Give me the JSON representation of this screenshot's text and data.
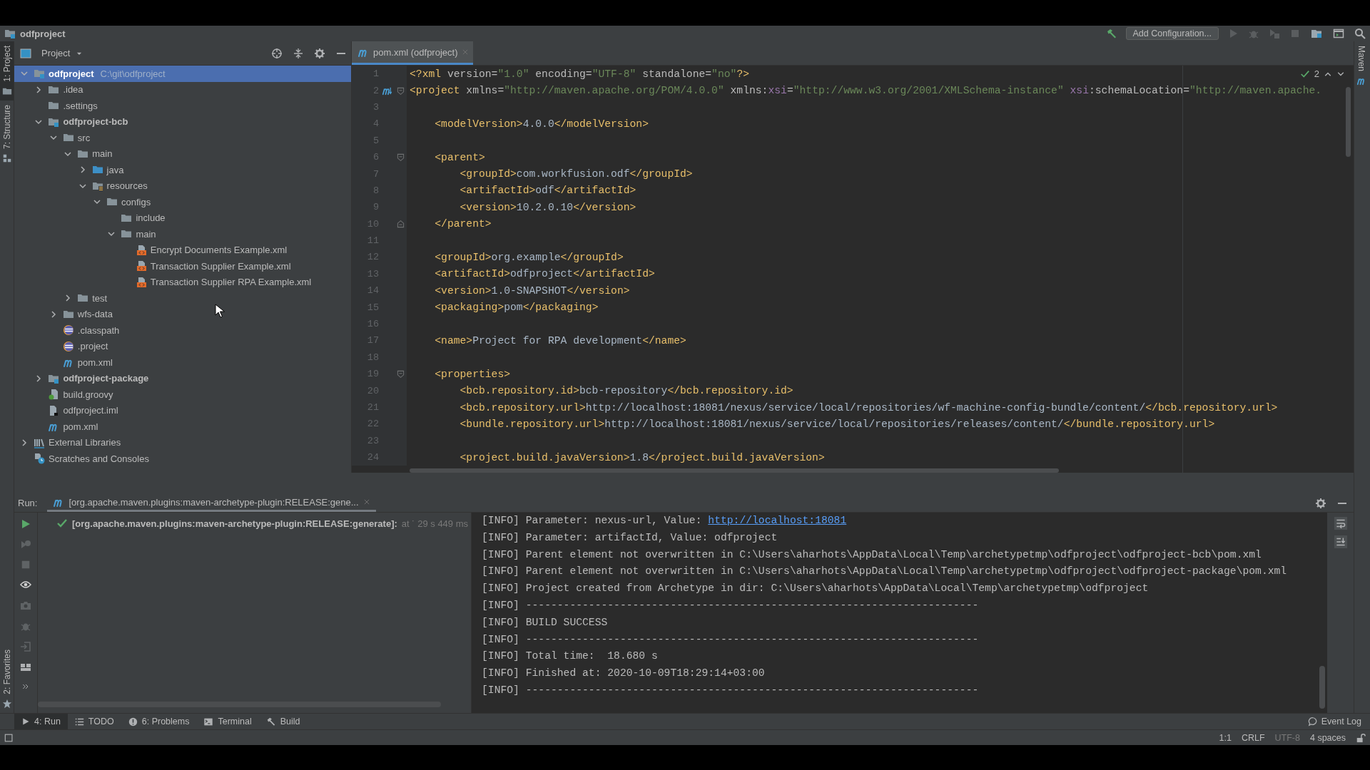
{
  "title_bar": {
    "project": "odfproject",
    "configuration_button": "Add Configuration..."
  },
  "left_strip": [
    {
      "label": "1: Project",
      "kind": "project",
      "selected": true
    },
    {
      "label": "7: Structure",
      "kind": "structure",
      "selected": false
    },
    {
      "label": "2: Favorites",
      "kind": "favorites",
      "selected": false
    }
  ],
  "right_strip": [
    {
      "label": "Maven",
      "selected": false
    }
  ],
  "project_panel": {
    "view": "Project",
    "tree": [
      {
        "label": "odfproject",
        "path": "C:\\git\\odfproject",
        "kind": "module",
        "selected": true,
        "expanded": true,
        "children": [
          {
            "label": ".idea",
            "kind": "folder",
            "selected": false,
            "expanded": false
          },
          {
            "label": ".settings",
            "kind": "folder",
            "selected": false
          },
          {
            "label": "odfproject-bcb",
            "kind": "module",
            "selected": false,
            "expanded": true,
            "children": [
              {
                "label": "src",
                "kind": "folder",
                "selected": false,
                "expanded": true,
                "children": [
                  {
                    "label": "main",
                    "kind": "folder",
                    "selected": false,
                    "expanded": true,
                    "children": [
                      {
                        "label": "java",
                        "kind": "source-folder",
                        "selected": false,
                        "expanded": false
                      },
                      {
                        "label": "resources",
                        "kind": "resources-folder",
                        "selected": false,
                        "expanded": true,
                        "children": [
                          {
                            "label": "configs",
                            "kind": "folder",
                            "selected": false,
                            "expanded": true,
                            "children": [
                              {
                                "label": "include",
                                "kind": "folder",
                                "selected": false
                              },
                              {
                                "label": "main",
                                "kind": "folder",
                                "selected": false,
                                "expanded": true,
                                "children": [
                                  {
                                    "label": "Encrypt Documents Example.xml",
                                    "kind": "xml-file",
                                    "selected": false
                                  },
                                  {
                                    "label": "Transaction Supplier Example.xml",
                                    "kind": "xml-file",
                                    "selected": false
                                  },
                                  {
                                    "label": "Transaction Supplier RPA Example.xml",
                                    "kind": "xml-file",
                                    "selected": false
                                  }
                                ]
                              }
                            ]
                          }
                        ]
                      }
                    ]
                  },
                  {
                    "label": "test",
                    "kind": "folder",
                    "selected": false,
                    "expanded": false
                  }
                ]
              },
              {
                "label": "wfs-data",
                "kind": "folder",
                "selected": false,
                "expanded": false
              },
              {
                "label": ".classpath",
                "kind": "eclipse-file",
                "selected": false
              },
              {
                "label": ".project",
                "kind": "eclipse-file",
                "selected": false
              },
              {
                "label": "pom.xml",
                "kind": "maven-file",
                "selected": false
              }
            ]
          },
          {
            "label": "odfproject-package",
            "kind": "module",
            "selected": false,
            "expanded": false
          },
          {
            "label": "build.groovy",
            "kind": "groovy-file",
            "selected": false
          },
          {
            "label": "odfproject.iml",
            "kind": "iml-file",
            "selected": false
          },
          {
            "label": "pom.xml",
            "kind": "maven-file",
            "selected": false
          }
        ]
      },
      {
        "label": "External Libraries",
        "kind": "libraries",
        "selected": false,
        "expanded": false
      },
      {
        "label": "Scratches and Consoles",
        "kind": "scratches",
        "selected": false
      }
    ]
  },
  "editor": {
    "tabs": [
      {
        "label": "pom.xml (odfproject)",
        "selected": true
      }
    ],
    "inspection": {
      "count": "2"
    },
    "lines": [
      {
        "number": "1",
        "kind": "plain",
        "tokens": [
          {
            "kind": "tag",
            "text": "<?xml "
          },
          {
            "kind": "attr",
            "text": "version="
          },
          {
            "kind": "value",
            "text": "\"1.0\""
          },
          {
            "kind": "attr",
            "text": " encoding="
          },
          {
            "kind": "value",
            "text": "\"UTF-8\""
          },
          {
            "kind": "attr",
            "text": " standalone="
          },
          {
            "kind": "value",
            "text": "\"no\""
          },
          {
            "kind": "tag",
            "text": "?>"
          }
        ]
      },
      {
        "number": "2",
        "kind": "maven-fold-start",
        "tokens": [
          {
            "kind": "tag",
            "text": "<project "
          },
          {
            "kind": "attr",
            "text": "xmlns="
          },
          {
            "kind": "value",
            "text": "\"http://maven.apache.org/POM/4.0.0\""
          },
          {
            "kind": "attr",
            "text": " xmlns:"
          },
          {
            "kind": "ns",
            "text": "xsi"
          },
          {
            "kind": "attr",
            "text": "="
          },
          {
            "kind": "value",
            "text": "\"http://www.w3.org/2001/XMLSchema-instance\""
          },
          {
            "kind": "ns",
            "text": " xsi"
          },
          {
            "kind": "attr",
            "text": ":schemaLocation="
          },
          {
            "kind": "value",
            "text": "\"http://maven.apache."
          }
        ]
      },
      {
        "number": "3",
        "kind": "plain"
      },
      {
        "number": "4",
        "kind": "plain",
        "tokens": [
          {
            "kind": "tag",
            "text": "    <modelVersion>"
          },
          {
            "kind": "text",
            "text": "4.0.0"
          },
          {
            "kind": "tag",
            "text": "</modelVersion>"
          }
        ]
      },
      {
        "number": "5",
        "kind": "plain"
      },
      {
        "number": "6",
        "kind": "fold-start",
        "tokens": [
          {
            "kind": "tag",
            "text": "    <parent>"
          }
        ]
      },
      {
        "number": "7",
        "kind": "plain",
        "tokens": [
          {
            "kind": "tag",
            "text": "        <groupId>"
          },
          {
            "kind": "text",
            "text": "com.workfusion.odf"
          },
          {
            "kind": "tag",
            "text": "</groupId>"
          }
        ]
      },
      {
        "number": "8",
        "kind": "plain",
        "tokens": [
          {
            "kind": "tag",
            "text": "        <artifactId>"
          },
          {
            "kind": "text",
            "text": "odf"
          },
          {
            "kind": "tag",
            "text": "</artifactId>"
          }
        ]
      },
      {
        "number": "9",
        "kind": "plain",
        "tokens": [
          {
            "kind": "tag",
            "text": "        <version>"
          },
          {
            "kind": "text",
            "text": "10.2.0.10"
          },
          {
            "kind": "tag",
            "text": "</version>"
          }
        ]
      },
      {
        "number": "10",
        "kind": "fold-end",
        "tokens": [
          {
            "kind": "tag",
            "text": "    </parent>"
          }
        ]
      },
      {
        "number": "11",
        "kind": "plain"
      },
      {
        "number": "12",
        "kind": "plain",
        "tokens": [
          {
            "kind": "tag",
            "text": "    <groupId>"
          },
          {
            "kind": "text",
            "text": "org.example"
          },
          {
            "kind": "tag",
            "text": "</groupId>"
          }
        ]
      },
      {
        "number": "13",
        "kind": "plain",
        "tokens": [
          {
            "kind": "tag",
            "text": "    <artifactId>"
          },
          {
            "kind": "text",
            "text": "odfproject"
          },
          {
            "kind": "tag",
            "text": "</artifactId>"
          }
        ]
      },
      {
        "number": "14",
        "kind": "plain",
        "tokens": [
          {
            "kind": "tag",
            "text": "    <version>"
          },
          {
            "kind": "text",
            "text": "1.0-SNAPSHOT"
          },
          {
            "kind": "tag",
            "text": "</version>"
          }
        ]
      },
      {
        "number": "15",
        "kind": "plain",
        "tokens": [
          {
            "kind": "tag",
            "text": "    <packaging>"
          },
          {
            "kind": "text",
            "text": "pom"
          },
          {
            "kind": "tag",
            "text": "</packaging>"
          }
        ]
      },
      {
        "number": "16",
        "kind": "plain"
      },
      {
        "number": "17",
        "kind": "plain",
        "tokens": [
          {
            "kind": "tag",
            "text": "    <name>"
          },
          {
            "kind": "text",
            "text": "Project for RPA development"
          },
          {
            "kind": "tag",
            "text": "</name>"
          }
        ]
      },
      {
        "number": "18",
        "kind": "plain"
      },
      {
        "number": "19",
        "kind": "fold-start",
        "tokens": [
          {
            "kind": "tag",
            "text": "    <properties>"
          }
        ]
      },
      {
        "number": "20",
        "kind": "plain",
        "tokens": [
          {
            "kind": "tag",
            "text": "        <bcb.repository.id>"
          },
          {
            "kind": "text",
            "text": "bcb-repository"
          },
          {
            "kind": "tag",
            "text": "</bcb.repository.id>"
          }
        ]
      },
      {
        "number": "21",
        "kind": "plain",
        "tokens": [
          {
            "kind": "tag",
            "text": "        <bcb.repository.url>"
          },
          {
            "kind": "text",
            "text": "http://localhost:18081/nexus/service/local/repositories/wf-machine-config-bundle/content/"
          },
          {
            "kind": "tag",
            "text": "</bcb.repository.url>"
          }
        ]
      },
      {
        "number": "22",
        "kind": "plain",
        "tokens": [
          {
            "kind": "tag",
            "text": "        <bundle.repository.url>"
          },
          {
            "kind": "text",
            "text": "http://localhost:18081/nexus/service/local/repositories/releases/content/"
          },
          {
            "kind": "tag",
            "text": "</bundle.repository.url>"
          }
        ]
      },
      {
        "number": "23",
        "kind": "plain"
      },
      {
        "number": "24",
        "kind": "plain",
        "tokens": [
          {
            "kind": "tag",
            "text": "        <project.build.javaVersion>"
          },
          {
            "kind": "text",
            "text": "1.8"
          },
          {
            "kind": "tag",
            "text": "</project.build.javaVersion>"
          }
        ]
      }
    ]
  },
  "run_panel": {
    "label": "Run:",
    "tabs": [
      {
        "label": "[org.apache.maven.plugins:maven-archetype-plugin:RELEASE:gene...",
        "selected": true
      }
    ],
    "tasks": [
      {
        "label": "[org.apache.maven.plugins:maven-archetype-plugin:RELEASE:generate]:",
        "detail": "at ˙ 29 s 449 ms",
        "succeeded": true
      }
    ],
    "console": [
      {
        "text": "[INFO] Parameter: nexus-url, Value: ",
        "link": "http://localhost:18081"
      },
      {
        "text": "[INFO] Parameter: artifactId, Value: odfproject"
      },
      {
        "text": "[INFO] Parent element not overwritten in C:\\Users\\aharhots\\AppData\\Local\\Temp\\archetypetmp\\odfproject\\odfproject-bcb\\pom.xml"
      },
      {
        "text": "[INFO] Parent element not overwritten in C:\\Users\\aharhots\\AppData\\Local\\Temp\\archetypetmp\\odfproject\\odfproject-package\\pom.xml"
      },
      {
        "text": "[INFO] Project created from Archetype in dir: C:\\Users\\aharhots\\AppData\\Local\\Temp\\archetypetmp\\odfproject"
      },
      {
        "text": "[INFO] ------------------------------------------------------------------------"
      },
      {
        "text": "[INFO] BUILD SUCCESS"
      },
      {
        "text": "[INFO] ------------------------------------------------------------------------"
      },
      {
        "text": "[INFO] Total time:  18.680 s"
      },
      {
        "text": "[INFO] Finished at: 2020-10-09T18:29:14+03:00"
      },
      {
        "text": "[INFO] ------------------------------------------------------------------------"
      }
    ]
  },
  "tool_tabs": [
    {
      "label": "4: Run",
      "kind": "run",
      "selected": true
    },
    {
      "label": "TODO",
      "kind": "todo",
      "selected": false
    },
    {
      "label": "6: Problems",
      "kind": "problems",
      "selected": false
    },
    {
      "label": "Terminal",
      "kind": "terminal",
      "selected": false
    },
    {
      "label": "Build",
      "kind": "build",
      "selected": false
    }
  ],
  "event_log": "Event Log",
  "status_bar": {
    "items": [
      {
        "text": "1:1",
        "disabled": false
      },
      {
        "text": "CRLF",
        "disabled": false
      },
      {
        "text": "UTF-8",
        "disabled": true
      },
      {
        "text": "4 spaces",
        "disabled": false
      }
    ]
  }
}
